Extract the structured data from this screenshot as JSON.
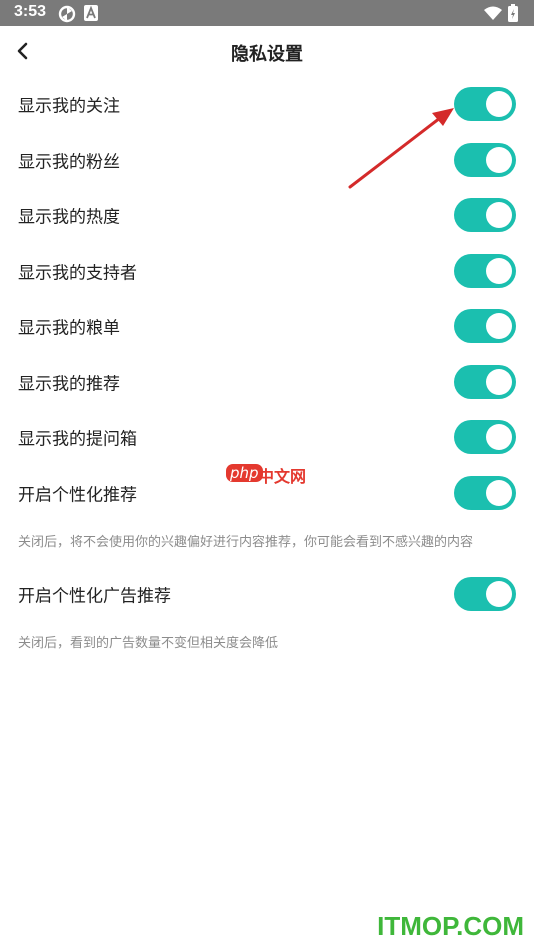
{
  "status_bar": {
    "time": "3:53",
    "icons": [
      "sync-icon",
      "notification-a-icon",
      "wifi-icon",
      "battery-icon"
    ]
  },
  "header": {
    "back_icon": "chevron-left-icon",
    "title": "隐私设置"
  },
  "settings": {
    "items": [
      {
        "label": "显示我的关注",
        "on": true
      },
      {
        "label": "显示我的粉丝",
        "on": true
      },
      {
        "label": "显示我的热度",
        "on": true
      },
      {
        "label": "显示我的支持者",
        "on": true
      },
      {
        "label": "显示我的粮单",
        "on": true
      },
      {
        "label": "显示我的推荐",
        "on": true
      },
      {
        "label": "显示我的提问箱",
        "on": true
      },
      {
        "label": "开启个性化推荐",
        "on": true,
        "description": "关闭后，将不会使用你的兴趣偏好进行内容推荐，你可能会看到不感兴趣的内容"
      },
      {
        "label": "开启个性化广告推荐",
        "on": true,
        "description": "关闭后，看到的广告数量不变但相关度会降低"
      }
    ]
  },
  "overlays": {
    "watermark_php": "php",
    "watermark_cn": "中文网",
    "site_watermark": "ITMOP.COM"
  },
  "colors": {
    "toggle_on": "#1bbfaf",
    "status_bar": "#7a7a7a",
    "arrow": "#d42a2a",
    "site_watermark": "#3fb73a"
  }
}
